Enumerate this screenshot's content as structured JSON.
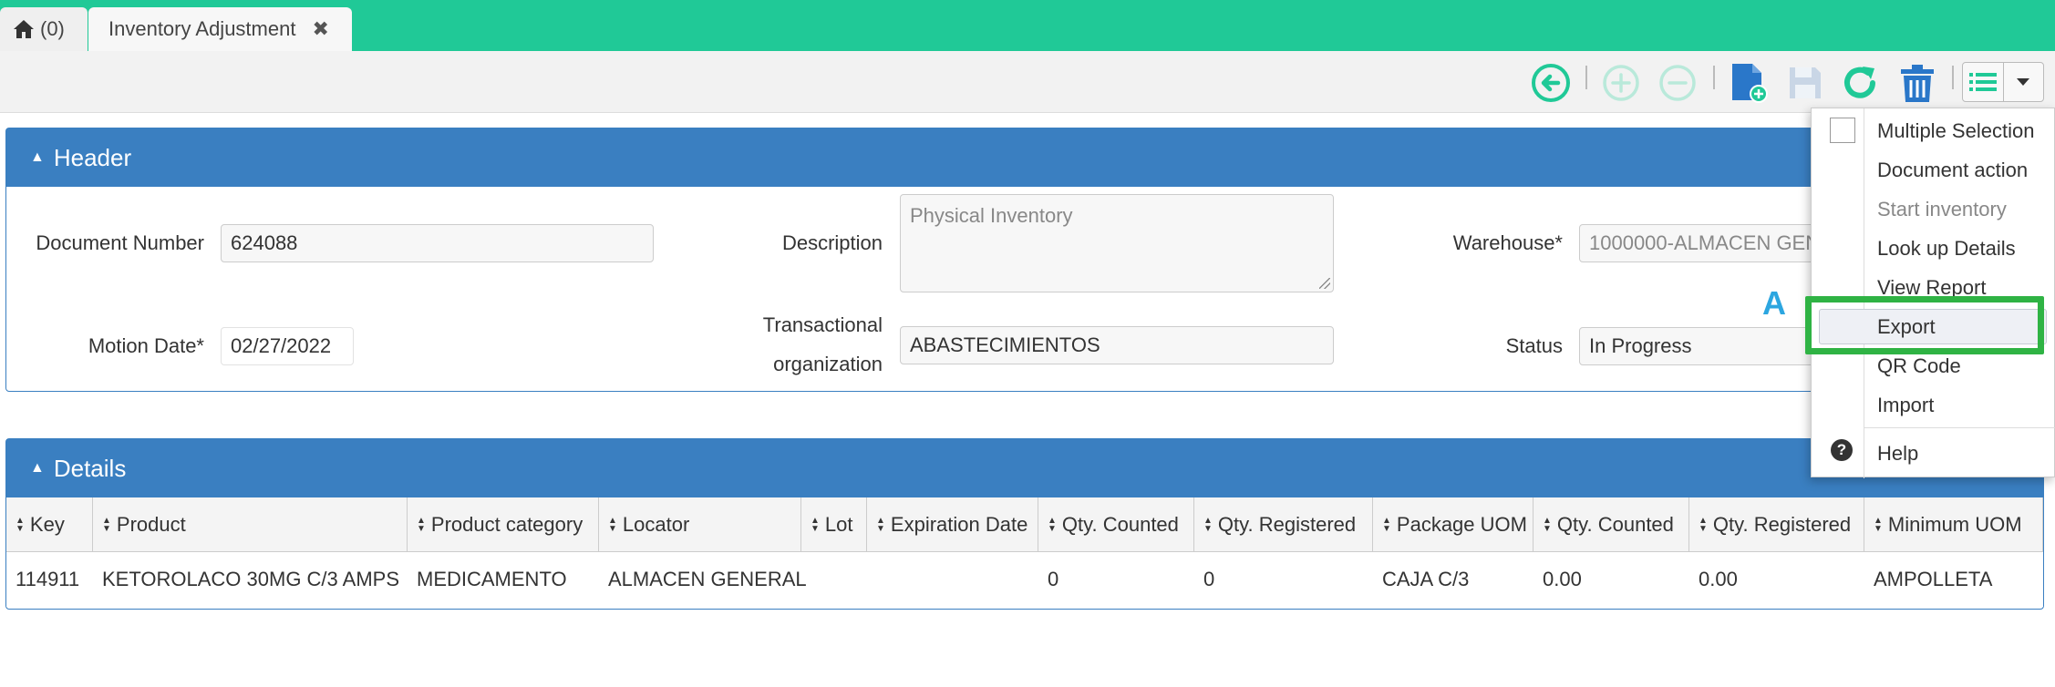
{
  "tabs": {
    "home_label": "(0)",
    "active_label": "Inventory Adjustment"
  },
  "icons": {
    "home": "home-icon",
    "close": "close-icon",
    "back": "back-circle-icon",
    "add": "add-circle-icon",
    "remove": "remove-circle-icon",
    "new_doc": "new-document-icon",
    "save": "save-icon",
    "refresh": "refresh-icon",
    "delete": "trash-icon",
    "list": "list-icon",
    "dropdown": "caret-down-icon",
    "help": "help-icon"
  },
  "colors": {
    "topbar": "#20c997",
    "panel_header": "#3a7fc1",
    "highlight_box": "#2fb344",
    "toolbar_green": "#20c997",
    "toolbar_blue": "#2a77c9"
  },
  "header": {
    "title": "Header",
    "document_number_label": "Document Number",
    "document_number": "624088",
    "description_label": "Description",
    "description": "Physical Inventory",
    "warehouse_label": "Warehouse*",
    "warehouse": "1000000-ALMACEN GENERAL",
    "motion_date_label": "Motion Date*",
    "motion_date": "02/27/2022",
    "transactional_label_1": "Transactional",
    "transactional_label_2": "organization",
    "transactional_organization": "ABASTECIMIENTOS",
    "status_label": "Status",
    "status": "In Progress"
  },
  "marker": "A",
  "details": {
    "title": "Details",
    "columns": [
      "Key",
      "Product",
      "Product category",
      "Locator",
      "Lot",
      "Expiration Date",
      "Qty. Counted",
      "Qty. Registered",
      "Package UOM",
      "Qty. Counted",
      "Qty. Registered",
      "Minimum UOM"
    ],
    "rows": [
      [
        "114911",
        "KETOROLACO 30MG C/3 AMPS",
        "MEDICAMENTO",
        "ALMACEN GENERAL",
        "",
        "",
        "0",
        "0",
        "CAJA C/3",
        "0.00",
        "0.00",
        "AMPOLLETA"
      ]
    ]
  },
  "menu": {
    "items": [
      {
        "label": "Multiple Selection",
        "disabled": false
      },
      {
        "label": "Document action",
        "disabled": false
      },
      {
        "label": "Start inventory",
        "disabled": true
      },
      {
        "label": "Look up Details",
        "disabled": false
      },
      {
        "label": "View Report",
        "disabled": false
      },
      {
        "label": "Export",
        "disabled": false,
        "highlighted": true
      },
      {
        "label": "QR Code",
        "disabled": false
      },
      {
        "label": "Import",
        "disabled": false
      },
      {
        "label": "Help",
        "disabled": false
      }
    ]
  }
}
